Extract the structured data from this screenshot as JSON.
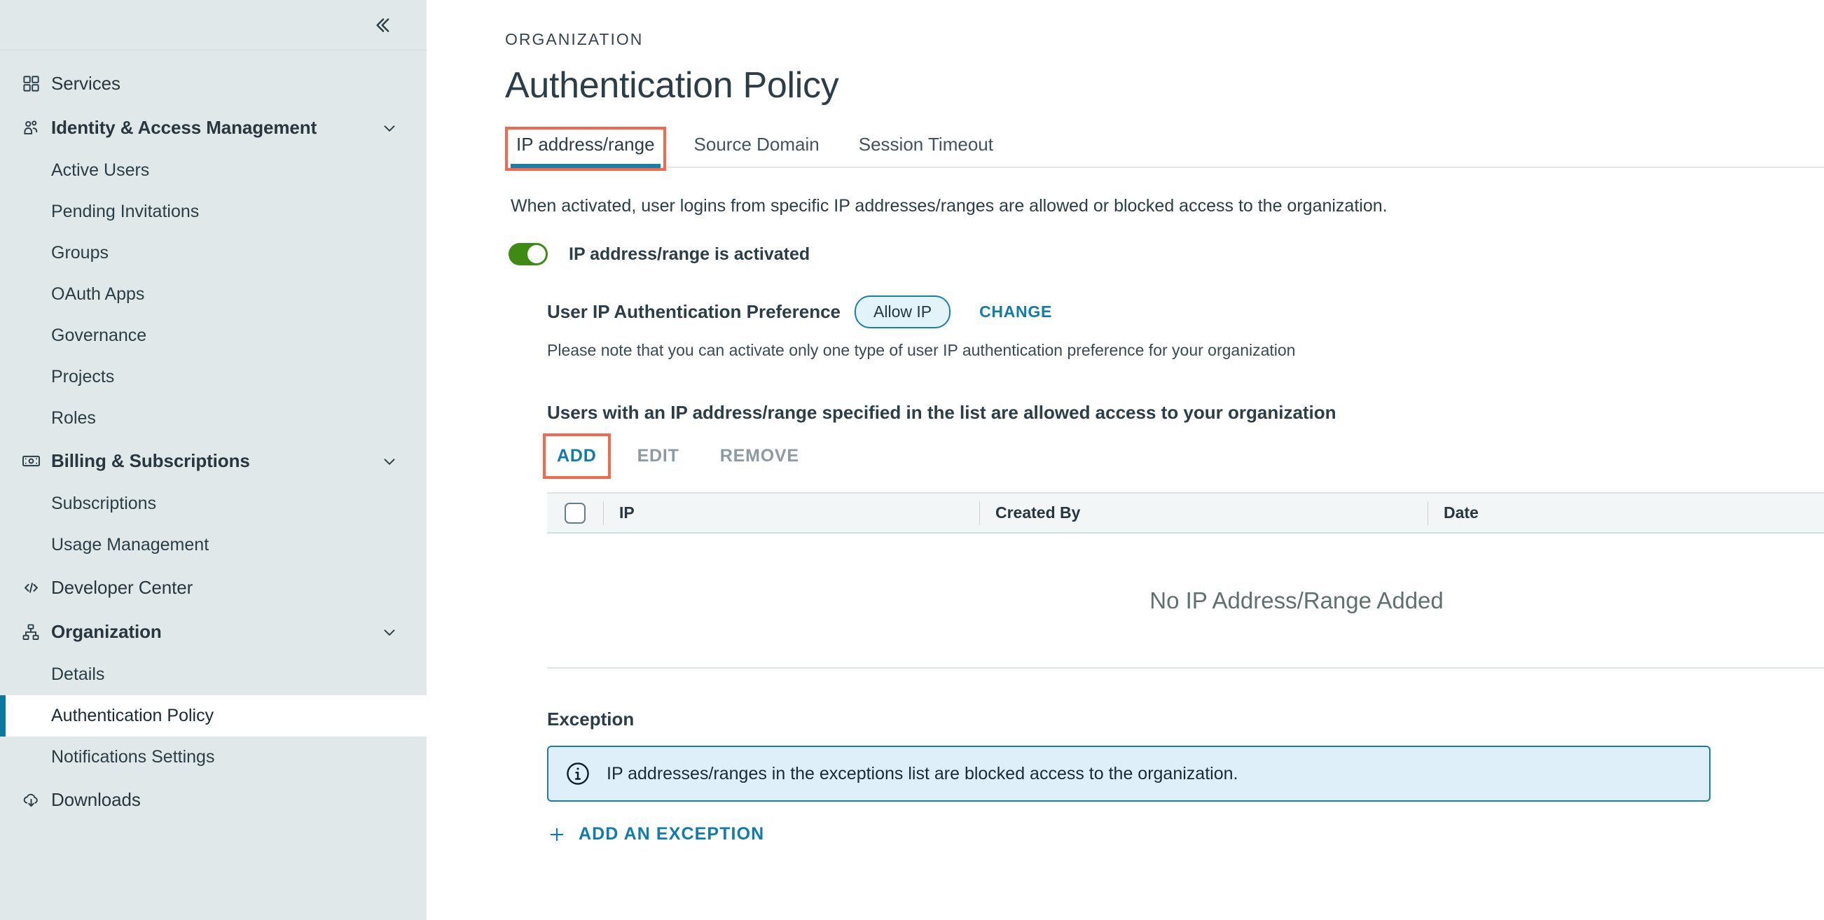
{
  "sidebar": {
    "collapse_icon": "chevron-double-left-icon",
    "items": [
      {
        "label": "Services",
        "icon": "grid-icon",
        "type": "group",
        "expandable": false,
        "active": false
      },
      {
        "label": "Identity & Access Management",
        "icon": "users-icon",
        "type": "group",
        "expandable": true,
        "active": false
      },
      {
        "label": "Active Users",
        "type": "sub",
        "active": false
      },
      {
        "label": "Pending Invitations",
        "type": "sub",
        "active": false
      },
      {
        "label": "Groups",
        "type": "sub",
        "active": false
      },
      {
        "label": "OAuth Apps",
        "type": "sub",
        "active": false
      },
      {
        "label": "Governance",
        "type": "sub",
        "active": false
      },
      {
        "label": "Projects",
        "type": "sub",
        "active": false
      },
      {
        "label": "Roles",
        "type": "sub",
        "active": false
      },
      {
        "label": "Billing & Subscriptions",
        "icon": "banknote-icon",
        "type": "group",
        "expandable": true,
        "active": false
      },
      {
        "label": "Subscriptions",
        "type": "sub",
        "active": false
      },
      {
        "label": "Usage Management",
        "type": "sub",
        "active": false
      },
      {
        "label": "Developer Center",
        "icon": "code-icon",
        "type": "group",
        "expandable": false,
        "active": false
      },
      {
        "label": "Organization",
        "icon": "org-chart-icon",
        "type": "group",
        "expandable": true,
        "active": false
      },
      {
        "label": "Details",
        "type": "sub",
        "active": false
      },
      {
        "label": "Authentication Policy",
        "type": "sub",
        "active": true
      },
      {
        "label": "Notifications Settings",
        "type": "sub",
        "active": false
      },
      {
        "label": "Downloads",
        "icon": "cloud-download-icon",
        "type": "group",
        "expandable": false,
        "active": false
      }
    ]
  },
  "main": {
    "eyebrow": "ORGANIZATION",
    "title": "Authentication Policy",
    "tabs": [
      {
        "label": "IP address/range",
        "active": true,
        "annotated": true
      },
      {
        "label": "Source Domain",
        "active": false,
        "annotated": false
      },
      {
        "label": "Session Timeout",
        "active": false,
        "annotated": false
      }
    ],
    "description": "When activated, user logins from specific IP addresses/ranges are allowed or blocked access to the organization.",
    "toggle": {
      "label": "IP address/range is activated",
      "state": "on",
      "color": "#3d8b13"
    },
    "preference": {
      "title": "User IP Authentication Preference",
      "badge": "Allow IP",
      "change_label": "CHANGE",
      "note": "Please note that you can activate only one type of user IP authentication preference for your organization"
    },
    "list": {
      "heading": "Users with an IP address/range specified in the list are allowed access to your organization",
      "actions": [
        {
          "label": "ADD",
          "enabled": true,
          "annotated": true
        },
        {
          "label": "EDIT",
          "enabled": false,
          "annotated": false
        },
        {
          "label": "REMOVE",
          "enabled": false,
          "annotated": false
        }
      ],
      "columns": [
        "IP",
        "Created By",
        "Date"
      ],
      "rows": [],
      "empty_message": "No IP Address/Range Added",
      "select_all_checked": false
    },
    "exception": {
      "title": "Exception",
      "alert_icon": "info-circle-icon",
      "alert_text": "IP addresses/ranges in the exceptions list are blocked access to the organization.",
      "add_icon": "plus-icon",
      "add_label": "ADD AN EXCEPTION"
    }
  },
  "colors": {
    "accent": "#0f7cab",
    "active_tab_underline": "#1a7fa8",
    "annotation": "#f4694d",
    "toggle_on": "#3d8b13",
    "sidebar_bg": "#e1e8ea",
    "alert_bg": "#deeffa"
  }
}
